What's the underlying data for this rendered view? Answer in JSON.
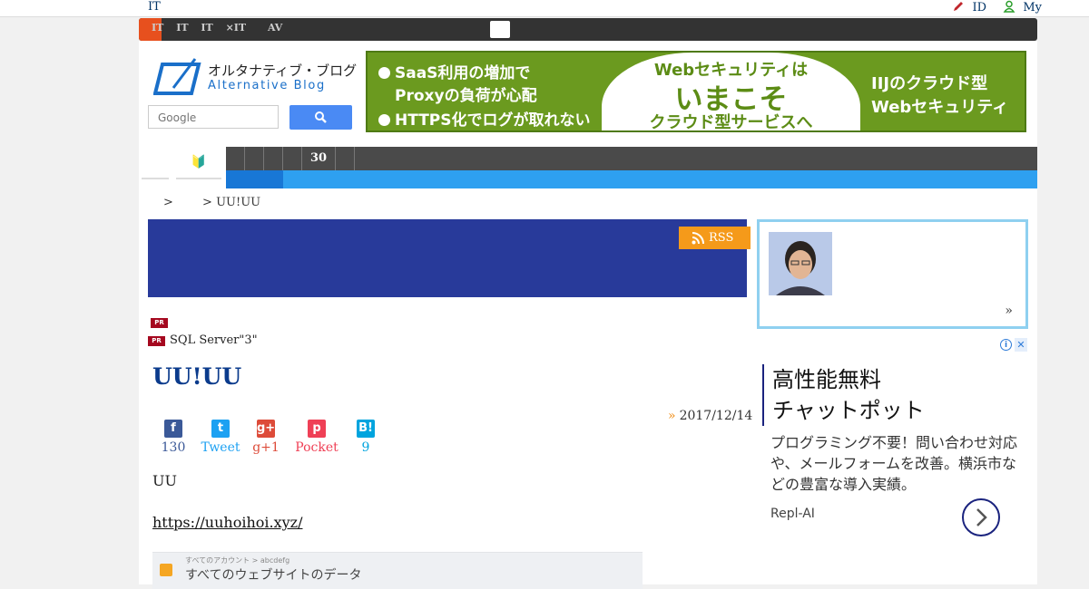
{
  "topbar": {
    "site": "IT",
    "login_label": "ID",
    "my_label": "My"
  },
  "navbar": {
    "items": [
      "IT",
      "IT",
      "IT",
      "×IT",
      "",
      "AV"
    ]
  },
  "logo": {
    "jp": "オルタナティブ・ブログ",
    "en": "Alternative Blog"
  },
  "search": {
    "placeholder": "Google"
  },
  "banner": {
    "left_lines": [
      "SaaS利用の増加で",
      "Proxyの負荷が心配",
      "HTTPS化でログが取れない"
    ],
    "center_line1": "Webセキュリティは",
    "center_line2": "いまこそ",
    "center_line3": "クラウド型サービスへ",
    "right_line1": "IIJのクラウド型",
    "right_line2": "Webセキュリティ"
  },
  "tabs": {
    "beginner_icon": "🔰"
  },
  "graybar": {
    "items": [
      "",
      "",
      "",
      "",
      "30",
      ""
    ]
  },
  "breadcrumb": {
    "sep1": ">",
    "current": "> UU!UU"
  },
  "rss": {
    "label": "RSS"
  },
  "pr": {
    "badge": "PR",
    "item2": "SQL Server\"3\""
  },
  "post": {
    "title": "UU!UU",
    "date": "2017/12/14",
    "raquo": "»",
    "body": "UU",
    "link": "https://uuhoihoi.xyz/"
  },
  "share": [
    {
      "label": "130",
      "color": "#3b5998",
      "icon": "f"
    },
    {
      "label": "Tweet",
      "color": "#1da1f2",
      "icon": "t"
    },
    {
      "label": "g+1",
      "color": "#dd4b39",
      "icon": "g+"
    },
    {
      "label": "Pocket",
      "color": "#ef4056",
      "icon": "p"
    },
    {
      "label": "9",
      "color": "#00a4de",
      "icon": "B!"
    }
  ],
  "screenshot": {
    "line1": "すべてのアカウント > abcdefg",
    "line2": "すべてのウェブサイトのデータ"
  },
  "profile": {
    "more": "»"
  },
  "ad": {
    "info": "i",
    "close": "✕",
    "headline1": "高性能無料",
    "headline2": "チャットポット",
    "description": "プログラミング不要！問い合わせ対応や、メールフォームを改善。横浜市などの豊富な導入実績。",
    "brand": "Repl-AI"
  }
}
